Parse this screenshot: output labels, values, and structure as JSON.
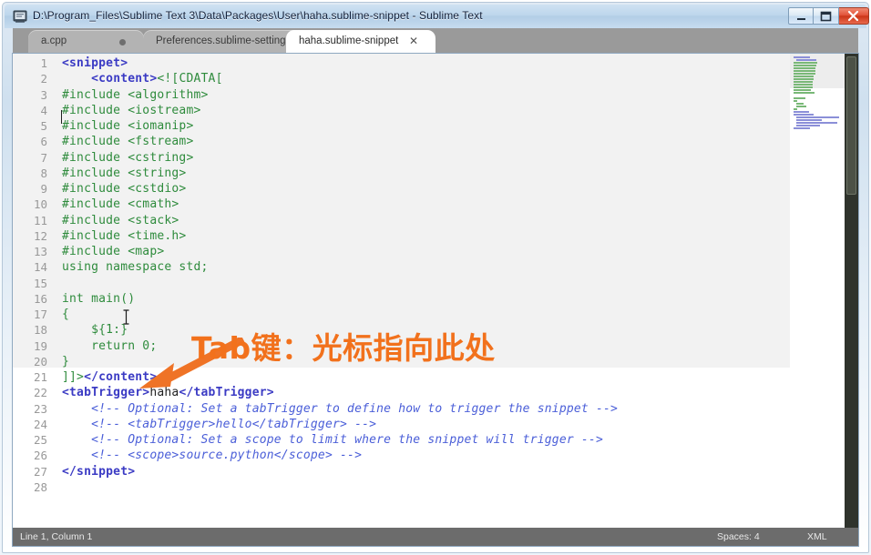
{
  "window": {
    "title": "D:\\Program_Files\\Sublime Text 3\\Data\\Packages\\User\\haha.sublime-snippet - Sublime Text",
    "app_icon": "sublime-text-icon",
    "controls": {
      "minimize": "minimize-icon",
      "maximize": "maximize-icon",
      "close": "close-icon"
    }
  },
  "tabs": [
    {
      "label": "a.cpp",
      "active": false,
      "indicator": "unsaved-dot"
    },
    {
      "label": "Preferences.sublime-settings",
      "active": false,
      "indicator": "close-x"
    },
    {
      "label": "haha.sublime-snippet",
      "active": true,
      "indicator": "close-x"
    }
  ],
  "editor": {
    "line_numbers": [
      "1",
      "2",
      "3",
      "4",
      "5",
      "6",
      "7",
      "8",
      "9",
      "10",
      "11",
      "12",
      "13",
      "14",
      "15",
      "16",
      "17",
      "18",
      "19",
      "20",
      "21",
      "22",
      "23",
      "24",
      "25",
      "26",
      "27",
      "28"
    ],
    "lines": [
      {
        "n": 1,
        "segments": [
          {
            "t": "tag",
            "s": "<snippet>"
          }
        ]
      },
      {
        "n": 2,
        "segments": [
          {
            "t": "plain",
            "s": "    "
          },
          {
            "t": "tag",
            "s": "<content>"
          },
          {
            "t": "cdata",
            "s": "<![CDATA["
          }
        ]
      },
      {
        "n": 3,
        "segments": [
          {
            "t": "green",
            "s": "#include <algorithm>"
          }
        ]
      },
      {
        "n": 4,
        "segments": [
          {
            "t": "green",
            "s": "#include <iostream>"
          }
        ]
      },
      {
        "n": 5,
        "segments": [
          {
            "t": "green",
            "s": "#include <iomanip>"
          }
        ]
      },
      {
        "n": 6,
        "segments": [
          {
            "t": "green",
            "s": "#include <fstream>"
          }
        ]
      },
      {
        "n": 7,
        "segments": [
          {
            "t": "green",
            "s": "#include <cstring>"
          }
        ]
      },
      {
        "n": 8,
        "segments": [
          {
            "t": "green",
            "s": "#include <string>"
          }
        ]
      },
      {
        "n": 9,
        "segments": [
          {
            "t": "green",
            "s": "#include <cstdio>"
          }
        ]
      },
      {
        "n": 10,
        "segments": [
          {
            "t": "green",
            "s": "#include <cmath>"
          }
        ]
      },
      {
        "n": 11,
        "segments": [
          {
            "t": "green",
            "s": "#include <stack>"
          }
        ]
      },
      {
        "n": 12,
        "segments": [
          {
            "t": "green",
            "s": "#include <time.h>"
          }
        ]
      },
      {
        "n": 13,
        "segments": [
          {
            "t": "green",
            "s": "#include <map>"
          }
        ]
      },
      {
        "n": 14,
        "segments": [
          {
            "t": "green",
            "s": "using namespace std;"
          }
        ]
      },
      {
        "n": 15,
        "segments": []
      },
      {
        "n": 16,
        "segments": [
          {
            "t": "green",
            "s": "int main()"
          }
        ]
      },
      {
        "n": 17,
        "segments": [
          {
            "t": "green",
            "s": "{"
          }
        ]
      },
      {
        "n": 18,
        "segments": [
          {
            "t": "green",
            "s": "    ${1:}"
          }
        ]
      },
      {
        "n": 19,
        "segments": [
          {
            "t": "green",
            "s": "    return 0;"
          }
        ]
      },
      {
        "n": 20,
        "segments": [
          {
            "t": "green",
            "s": "}"
          }
        ]
      },
      {
        "n": 21,
        "segments": [
          {
            "t": "cdata",
            "s": "]]>"
          },
          {
            "t": "tag",
            "s": "</content>"
          }
        ]
      },
      {
        "n": 22,
        "segments": [
          {
            "t": "tag",
            "s": "<tabTrigger>"
          },
          {
            "t": "text",
            "s": "haha"
          },
          {
            "t": "tag",
            "s": "</tabTrigger>"
          }
        ]
      },
      {
        "n": 23,
        "segments": [
          {
            "t": "plain",
            "s": "    "
          },
          {
            "t": "comment",
            "s": "<!-- Optional: Set a tabTrigger to define how to trigger the snippet -->"
          }
        ]
      },
      {
        "n": 24,
        "segments": [
          {
            "t": "plain",
            "s": "    "
          },
          {
            "t": "comment",
            "s": "<!-- <tabTrigger>hello</tabTrigger> -->"
          }
        ]
      },
      {
        "n": 25,
        "segments": [
          {
            "t": "plain",
            "s": "    "
          },
          {
            "t": "comment",
            "s": "<!-- Optional: Set a scope to limit where the snippet will trigger -->"
          }
        ]
      },
      {
        "n": 26,
        "segments": [
          {
            "t": "plain",
            "s": "    "
          },
          {
            "t": "comment",
            "s": "<!-- <scope>source.python</scope> -->"
          }
        ]
      },
      {
        "n": 27,
        "segments": [
          {
            "t": "tag",
            "s": "</snippet>"
          }
        ]
      },
      {
        "n": 28,
        "segments": []
      }
    ]
  },
  "annotation": {
    "text": "Tab键：光标指向此处",
    "color": "#f2711c",
    "arrow": "arrow-pointing-down-left"
  },
  "status_bar": {
    "line_column": "Line 1, Column 1",
    "spaces": "Spaces: 4",
    "syntax": "XML"
  },
  "colors": {
    "tag": "#3b3bc4",
    "string_green": "#2e8b3c",
    "comment_blue": "#4a5ed8",
    "annotation_orange": "#f2711c",
    "tabbar_grey": "#9a9a9a",
    "statusbar_grey": "#6c6c6c",
    "active_block": "#f2f2f2"
  }
}
